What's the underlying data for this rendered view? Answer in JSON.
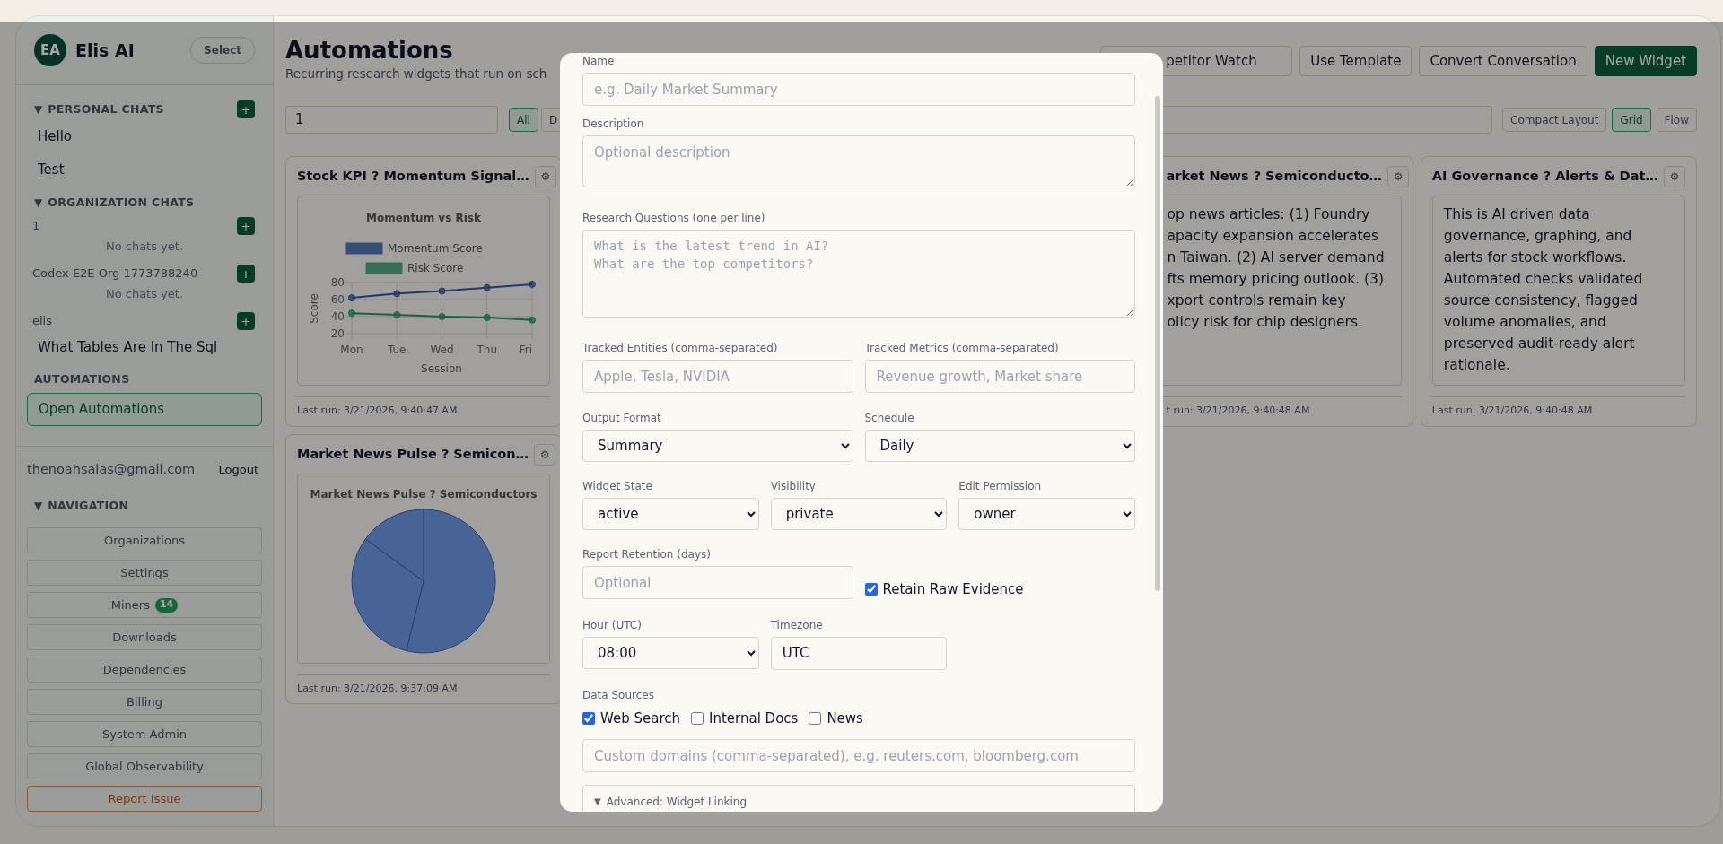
{
  "sidebar": {
    "avatar": "EA",
    "brand": "Elis AI",
    "select_button": "Select",
    "personal_chats": {
      "toggle": "▼",
      "heading": "PERSONAL CHATS",
      "add": "+",
      "chats": [
        "Hello",
        "Test"
      ]
    },
    "organization_chats": {
      "toggle": "▼",
      "heading": "ORGANIZATION CHATS",
      "orgs": [
        {
          "name": "1",
          "add": "+",
          "empty": "No chats yet."
        },
        {
          "name": "Codex E2E Org 1773788240",
          "add": "+",
          "empty": "No chats yet."
        },
        {
          "name": "elis",
          "add": "+",
          "chats": [
            "What Tables Are In The Sql"
          ]
        }
      ]
    },
    "automations": {
      "heading": "AUTOMATIONS",
      "button": "Open Automations",
      "selected": true
    },
    "account": {
      "email": "thenoahsalas@gmail.com",
      "logout": "Logout"
    },
    "navigation": {
      "toggle": "▼",
      "heading": "NAVIGATION",
      "items": [
        {
          "label": "Organizations",
          "kind": "link"
        },
        {
          "label": "Settings",
          "kind": "link"
        },
        {
          "label": "Miners",
          "kind": "link",
          "badge": "14"
        },
        {
          "label": "Downloads",
          "kind": "link"
        },
        {
          "label": "Dependencies",
          "kind": "link"
        },
        {
          "label": "Billing",
          "kind": "link"
        },
        {
          "label": "System Admin",
          "kind": "link"
        },
        {
          "label": "Global Observability",
          "kind": "link"
        },
        {
          "label": "Report Issue",
          "kind": "report"
        }
      ]
    }
  },
  "header": {
    "title": "Automations",
    "subtitle": "Recurring research widgets that run on sch",
    "template_select": "petitor Watch",
    "buttons": [
      {
        "label": "Use Template",
        "kind": "secondary"
      },
      {
        "label": "Convert Conversation",
        "kind": "secondary"
      },
      {
        "label": "New Widget",
        "kind": "primary"
      }
    ]
  },
  "filters": {
    "org_select": "1",
    "types": [
      {
        "label": "All",
        "selected": true
      },
      {
        "label": "D",
        "selected": false
      }
    ],
    "layouts": [
      {
        "label": "Compact Layout",
        "selected": false
      },
      {
        "label": "Grid",
        "selected": true
      },
      {
        "label": "Flow",
        "selected": false
      }
    ]
  },
  "widgets": [
    {
      "kind": "line_chart",
      "title": "Stock KPI ? Momentum Signal…",
      "menu": "⚙",
      "last_run": "Last run: 3/21/2026, 9:40:47 AM",
      "chart_data": {
        "type": "line",
        "title": "Momentum vs Risk",
        "xlabel": "Session",
        "ylabel": "Score",
        "categories": [
          "Mon",
          "Tue",
          "Wed",
          "Thu",
          "Fri"
        ],
        "ylim": [
          20,
          80
        ],
        "yticks": [
          20,
          40,
          60,
          80
        ],
        "grid": true,
        "legend": "top",
        "series": [
          {
            "name": "Momentum Score",
            "color": "#2f58a8",
            "marker": "circle",
            "values": [
              62,
              67,
              70,
              74,
              78
            ]
          },
          {
            "name": "Risk Score",
            "color": "#23996a",
            "marker": "circle",
            "values": [
              44,
              42,
              40,
              39,
              36
            ]
          }
        ]
      }
    },
    {
      "kind": "text",
      "title": "arket News ? Semiconducto…",
      "menu": "⚙",
      "last_run": "t run: 3/21/2026, 9:40:48 AM",
      "body_lines": [
        "op news articles: (1) Foundry",
        "apacity expansion accelerates",
        "n Taiwan. (2) AI server demand",
        "fts memory pricing outlook. (3)",
        "xport controls remain key",
        "olicy risk for chip designers."
      ]
    },
    {
      "kind": "text",
      "title": "AI Governance ? Alerts & Dat…",
      "menu": "⚙",
      "last_run": "Last run: 3/21/2026, 9:40:48 AM",
      "body": "This is AI driven data governance, graphing, and alerts for stock workflows. Automated checks validated source consistency, flagged volume anomalies, and preserved audit-ready alert rationale."
    },
    {
      "kind": "pie_chart",
      "title": "Market News Pulse ? Semicon…",
      "menu": "⚙",
      "last_run": "Last run: 3/21/2026, 9:37:09 AM",
      "chart_title": "Market News Pulse ? Semiconductors"
    }
  ],
  "modal": {
    "rows": [
      {
        "kind": "single",
        "fields": [
          {
            "kind": "input",
            "label": "Name",
            "placeholder": "e.g. Daily Market Summary"
          }
        ]
      },
      {
        "kind": "single",
        "fields": [
          {
            "kind": "textarea",
            "label": "Description",
            "placeholder": "Optional description"
          }
        ]
      },
      {
        "kind": "single",
        "fields": [
          {
            "kind": "codearea",
            "label": "Research Questions (one per line)",
            "placeholder": "What is the latest trend in AI?\nWhat are the top competitors?"
          }
        ]
      },
      {
        "kind": "pair",
        "fields": [
          {
            "kind": "input",
            "label": "Tracked Entities (comma-separated)",
            "placeholder": "Apple, Tesla, NVIDIA"
          },
          {
            "kind": "input",
            "label": "Tracked Metrics (comma-separated)",
            "placeholder": "Revenue growth, Market share"
          }
        ]
      },
      {
        "kind": "pair",
        "fields": [
          {
            "kind": "select",
            "label": "Output Format",
            "value": "Summary"
          },
          {
            "kind": "select",
            "label": "Schedule",
            "value": "Daily"
          }
        ]
      },
      {
        "kind": "triple",
        "fields": [
          {
            "kind": "select",
            "label": "Widget State",
            "value": "active"
          },
          {
            "kind": "select",
            "label": "Visibility",
            "value": "private"
          },
          {
            "kind": "select",
            "label": "Edit Permission",
            "value": "owner"
          }
        ]
      },
      {
        "kind": "pair",
        "fields": [
          {
            "kind": "input",
            "label": "Report Retention (days)",
            "placeholder": "Optional"
          },
          {
            "kind": "checkbox",
            "label": "Retain Raw Evidence",
            "checked": true
          }
        ]
      },
      {
        "kind": "triple",
        "fields": [
          {
            "kind": "select",
            "label": "Hour (UTC)",
            "value": "08:00"
          },
          {
            "kind": "input",
            "label": "Timezone",
            "value": "UTC"
          }
        ]
      },
      {
        "kind": "single",
        "fields": [
          {
            "kind": "checkgroup",
            "label": "Data Sources",
            "options": [
              {
                "label": "Web Search",
                "checked": true
              },
              {
                "label": "Internal Docs",
                "checked": false
              },
              {
                "label": "News",
                "checked": false
              }
            ]
          }
        ]
      },
      {
        "kind": "single",
        "fields": [
          {
            "kind": "input",
            "placeholder": "Custom domains (comma-separated), e.g. reuters.com, bloomberg.com"
          }
        ]
      },
      {
        "kind": "single",
        "fields": [
          {
            "kind": "details",
            "toggle": "▼",
            "label": "Advanced: Widget Linking"
          }
        ]
      }
    ]
  }
}
